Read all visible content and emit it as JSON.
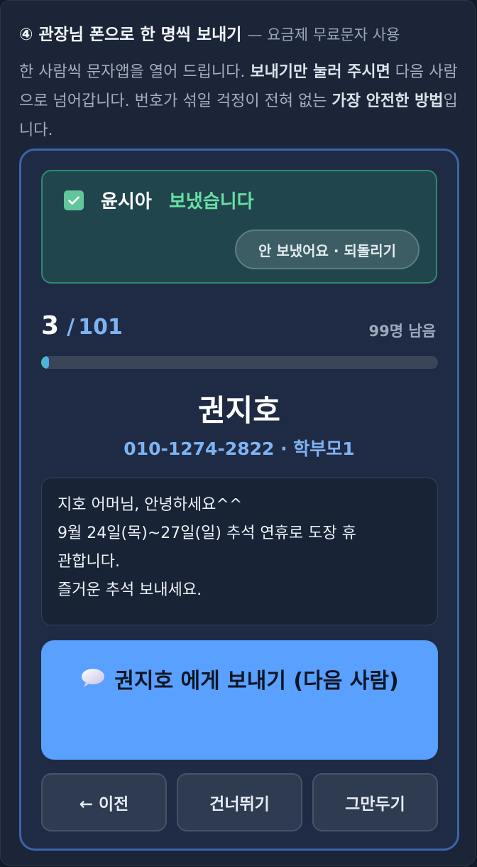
{
  "heading": {
    "title": "④ 관장님 폰으로 한 명씩 보내기",
    "subtitle": "— 요금제 무료문자 사용"
  },
  "description": {
    "part1": "한 사람씩 문자앱을 열어 드립니다. ",
    "bold1": "보내기만 눌러 주시면",
    "part2": " 다음 사람으로 넘어갑니다. 번호가 섞일 걱정이 전혀 없는 ",
    "bold2": "가장 안전한 방법",
    "part3": "입니다."
  },
  "sent": {
    "name": "윤시아",
    "status": "보냈습니다",
    "undo_label": "안 보냈어요 · 되돌리기",
    "checked": true
  },
  "progress": {
    "current": "3",
    "separator": "/",
    "total": "101",
    "remaining": "99명 남음",
    "fraction": 0.02
  },
  "recipient": {
    "name": "권지호",
    "meta": "010-1274-2822 · 학부모1"
  },
  "message": {
    "lines": [
      "지호 어머님, 안녕하세요^^",
      "9월 24일(목)~27일(일) 추석 연휴로 도장 휴",
      "관합니다.",
      "즐거운 추석 보내세요."
    ]
  },
  "send_button": {
    "icon": "speech-bubble-icon",
    "label": "권지호 에게 보내기 (다음 사람)"
  },
  "nav": {
    "prev_label": "← 이전",
    "skip_label": "건너뛰기",
    "stop_label": "그만두기"
  },
  "colors": {
    "accent": "#5aa0ff",
    "success": "#67e0a6",
    "card_border": "#3c64a9"
  }
}
